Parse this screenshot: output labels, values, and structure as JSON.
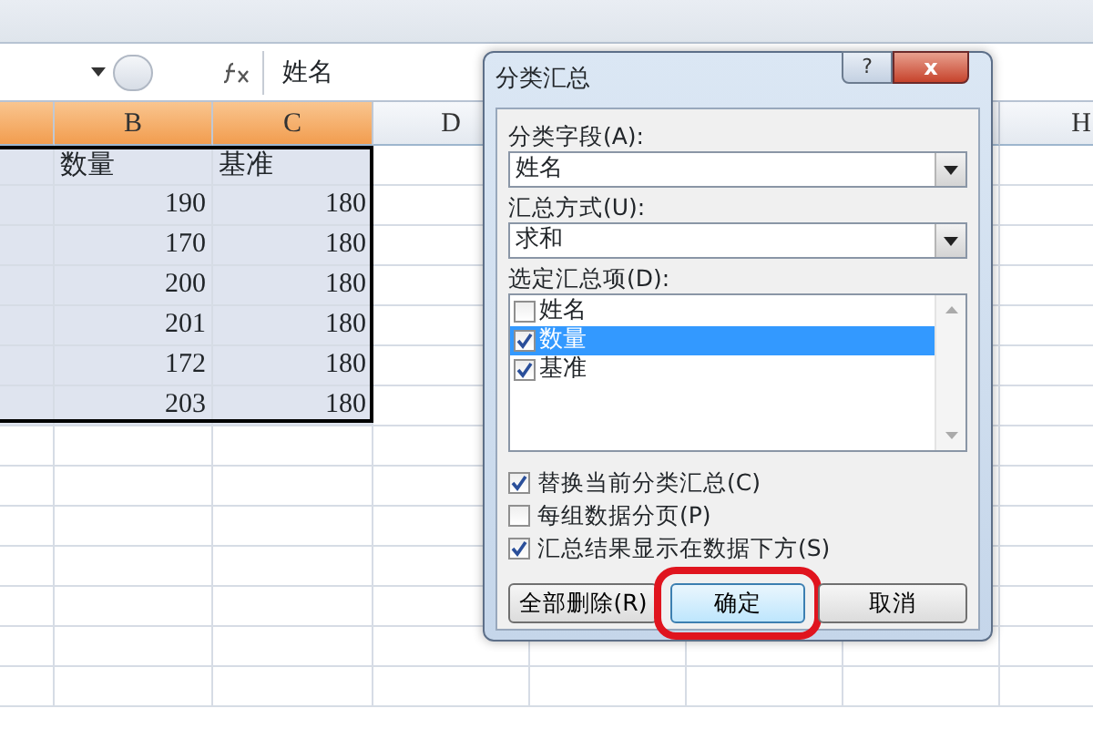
{
  "formula_bar": {
    "value": "姓名"
  },
  "sheet": {
    "columns": [
      {
        "label": "B",
        "selected": true
      },
      {
        "label": "C",
        "selected": true
      },
      {
        "label": "D",
        "selected": false
      },
      {
        "label": "H",
        "selected": false
      }
    ],
    "rows": [
      {
        "kind": "text",
        "cells": [
          "数量",
          "基准"
        ]
      },
      {
        "kind": "number",
        "cells": [
          "190",
          "180"
        ]
      },
      {
        "kind": "number",
        "cells": [
          "170",
          "180"
        ]
      },
      {
        "kind": "number",
        "cells": [
          "200",
          "180"
        ]
      },
      {
        "kind": "number",
        "cells": [
          "201",
          "180"
        ]
      },
      {
        "kind": "number",
        "cells": [
          "172",
          "180"
        ]
      },
      {
        "kind": "number",
        "cells": [
          "203",
          "180"
        ]
      }
    ]
  },
  "dialog": {
    "title": "分类汇总",
    "help": "?",
    "close": "x",
    "group_by": {
      "label": "分类字段(A):",
      "value": "姓名"
    },
    "function": {
      "label": "汇总方式(U):",
      "value": "求和"
    },
    "items_label": "选定汇总项(D):",
    "items": [
      {
        "label": "姓名",
        "checked": false,
        "selected": false
      },
      {
        "label": "数量",
        "checked": true,
        "selected": true
      },
      {
        "label": "基准",
        "checked": true,
        "selected": false
      }
    ],
    "options": [
      {
        "label": "替换当前分类汇总(C)",
        "checked": true
      },
      {
        "label": "每组数据分页(P)",
        "checked": false
      },
      {
        "label": "汇总结果显示在数据下方(S)",
        "checked": true
      }
    ],
    "buttons": [
      {
        "label": "全部删除(R)",
        "highlighted": false
      },
      {
        "label": "确定",
        "highlighted": true
      },
      {
        "label": "取消",
        "highlighted": false
      }
    ]
  }
}
